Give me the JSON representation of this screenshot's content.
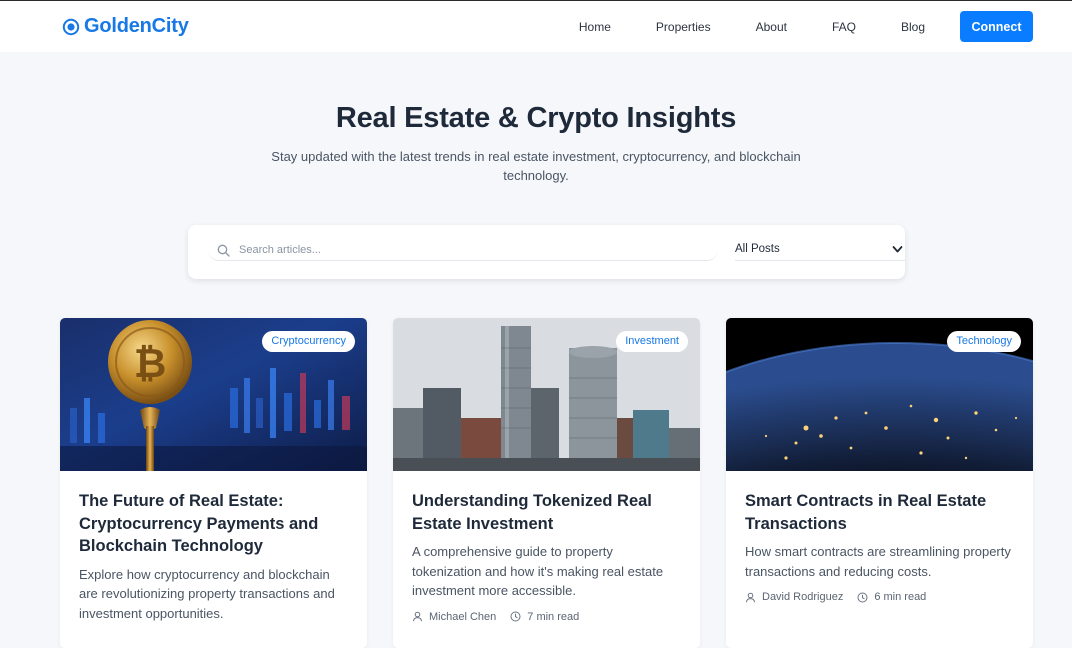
{
  "brand": {
    "name": "GoldenCity",
    "color": "#1778e6"
  },
  "nav": {
    "links": [
      "Home",
      "Properties",
      "About",
      "FAQ",
      "Blog"
    ],
    "connect_label": "Connect"
  },
  "hero": {
    "title": "Real Estate & Crypto Insights",
    "subtitle": "Stay updated with the latest trends in real estate investment, cryptocurrency, and blockchain technology."
  },
  "search": {
    "placeholder": "Search articles...",
    "value": "",
    "filter_selected": "All Posts"
  },
  "posts": [
    {
      "category": "Cryptocurrency",
      "image": "bitcoin-coin-photo",
      "title": "The Future of Real Estate: Cryptocurrency Payments and Blockchain Technology",
      "excerpt": "Explore how cryptocurrency and blockchain are revolutionizing property transactions and investment opportunities.",
      "author": "",
      "read_time": ""
    },
    {
      "category": "Investment",
      "image": "city-skyline-photo",
      "title": "Understanding Tokenized Real Estate Investment",
      "excerpt": "A comprehensive guide to property tokenization and how it's making real estate investment more accessible.",
      "author": "Michael Chen",
      "read_time": "7 min read"
    },
    {
      "category": "Technology",
      "image": "earth-at-night-photo",
      "title": "Smart Contracts in Real Estate Transactions",
      "excerpt": "How smart contracts are streamlining property transactions and reducing costs.",
      "author": "David Rodriguez",
      "read_time": "6 min read"
    }
  ],
  "colors": {
    "accent": "#0a7cff",
    "page_bg": "#f5f7fa",
    "text": "#1e2939",
    "muted": "#4a5563"
  }
}
